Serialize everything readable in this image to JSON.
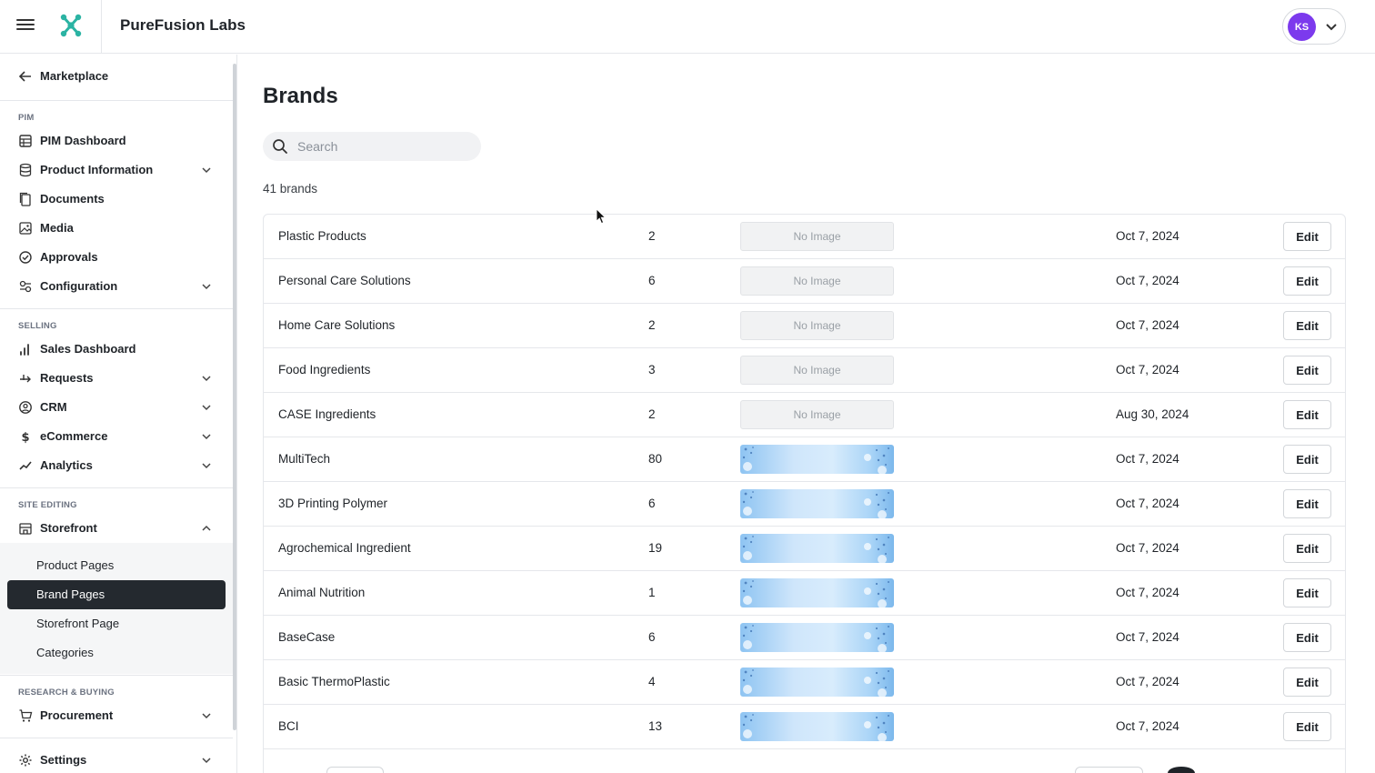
{
  "app": {
    "title": "PureFusion Labs",
    "user_initials": "KS"
  },
  "sidebar": {
    "back_link": "Marketplace",
    "sections": {
      "pim": "PIM",
      "selling": "SELLING",
      "site_editing": "SITE EDITING",
      "research": "RESEARCH & BUYING"
    },
    "items": {
      "pim_dashboard": "PIM Dashboard",
      "product_information": "Product Information",
      "documents": "Documents",
      "media": "Media",
      "approvals": "Approvals",
      "configuration": "Configuration",
      "sales_dashboard": "Sales Dashboard",
      "requests": "Requests",
      "crm": "CRM",
      "ecommerce": "eCommerce",
      "analytics": "Analytics",
      "storefront": "Storefront",
      "procurement": "Procurement",
      "settings": "Settings"
    },
    "storefront_sub": [
      "Product Pages",
      "Brand Pages",
      "Storefront Page",
      "Categories"
    ],
    "active_sub": "Brand Pages"
  },
  "main": {
    "title": "Brands",
    "search_placeholder": "Search",
    "count_label": "41 brands",
    "no_image_label": "No Image",
    "edit_label": "Edit",
    "rows": [
      {
        "name": "Plastic Products",
        "count": "2",
        "image": "none",
        "date": "Oct 7, 2024"
      },
      {
        "name": "Personal Care Solutions",
        "count": "6",
        "image": "none",
        "date": "Oct 7, 2024"
      },
      {
        "name": "Home Care Solutions",
        "count": "2",
        "image": "none",
        "date": "Oct 7, 2024"
      },
      {
        "name": "Food Ingredients",
        "count": "3",
        "image": "none",
        "date": "Oct 7, 2024"
      },
      {
        "name": "CASE Ingredients",
        "count": "2",
        "image": "none",
        "date": "Aug 30, 2024"
      },
      {
        "name": "MultiTech",
        "count": "80",
        "image": "banner",
        "date": "Oct 7, 2024"
      },
      {
        "name": "3D Printing Polymer",
        "count": "6",
        "image": "banner",
        "date": "Oct 7, 2024"
      },
      {
        "name": "Agrochemical Ingredient",
        "count": "19",
        "image": "banner",
        "date": "Oct 7, 2024"
      },
      {
        "name": "Animal Nutrition",
        "count": "1",
        "image": "banner",
        "date": "Oct 7, 2024"
      },
      {
        "name": "BaseCase",
        "count": "6",
        "image": "banner",
        "date": "Oct 7, 2024"
      },
      {
        "name": "Basic ThermoPlastic",
        "count": "4",
        "image": "banner",
        "date": "Oct 7, 2024"
      },
      {
        "name": "BCI",
        "count": "13",
        "image": "banner",
        "date": "Oct 7, 2024"
      }
    ]
  },
  "colors": {
    "active_nav_bg": "#24292f",
    "avatar_bg": "#7c3aed",
    "logo": "#2bb3a3"
  },
  "icons": {
    "menu": "hamburger-icon",
    "logo": "molecule-logo-icon",
    "back": "arrow-left-icon",
    "search": "search-icon",
    "chevron": "chevron-down-icon"
  }
}
